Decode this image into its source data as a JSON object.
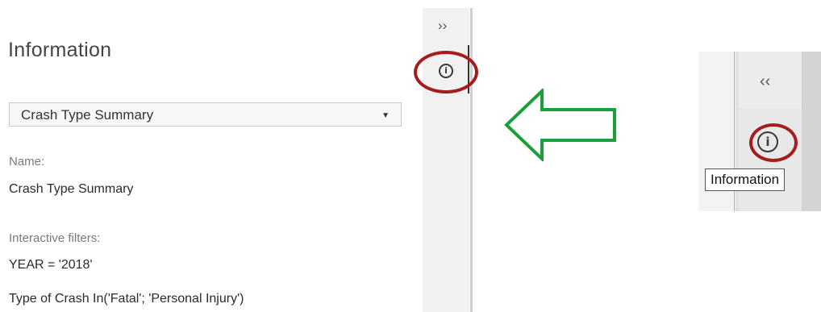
{
  "panel": {
    "title": "Information",
    "selector": {
      "selected": "Crash Type Summary"
    },
    "name_label": "Name:",
    "name_value": "Crash Type Summary",
    "filters_label": "Interactive filters:",
    "filters": [
      "YEAR = '2018'",
      "Type of Crash In('Fatal'; 'Personal Injury')"
    ]
  },
  "rail": {
    "expand_glyph": "››",
    "info_glyph": "i"
  },
  "inset": {
    "collapse_glyph": "‹‹",
    "info_glyph": "i",
    "tooltip": "Information"
  },
  "colors": {
    "highlight_ring": "#a51c1c",
    "arrow_stroke": "#1aa03a"
  },
  "icons": [
    "chevron-double-right-icon",
    "info-icon",
    "chevron-double-left-icon",
    "arrow-left-icon"
  ]
}
